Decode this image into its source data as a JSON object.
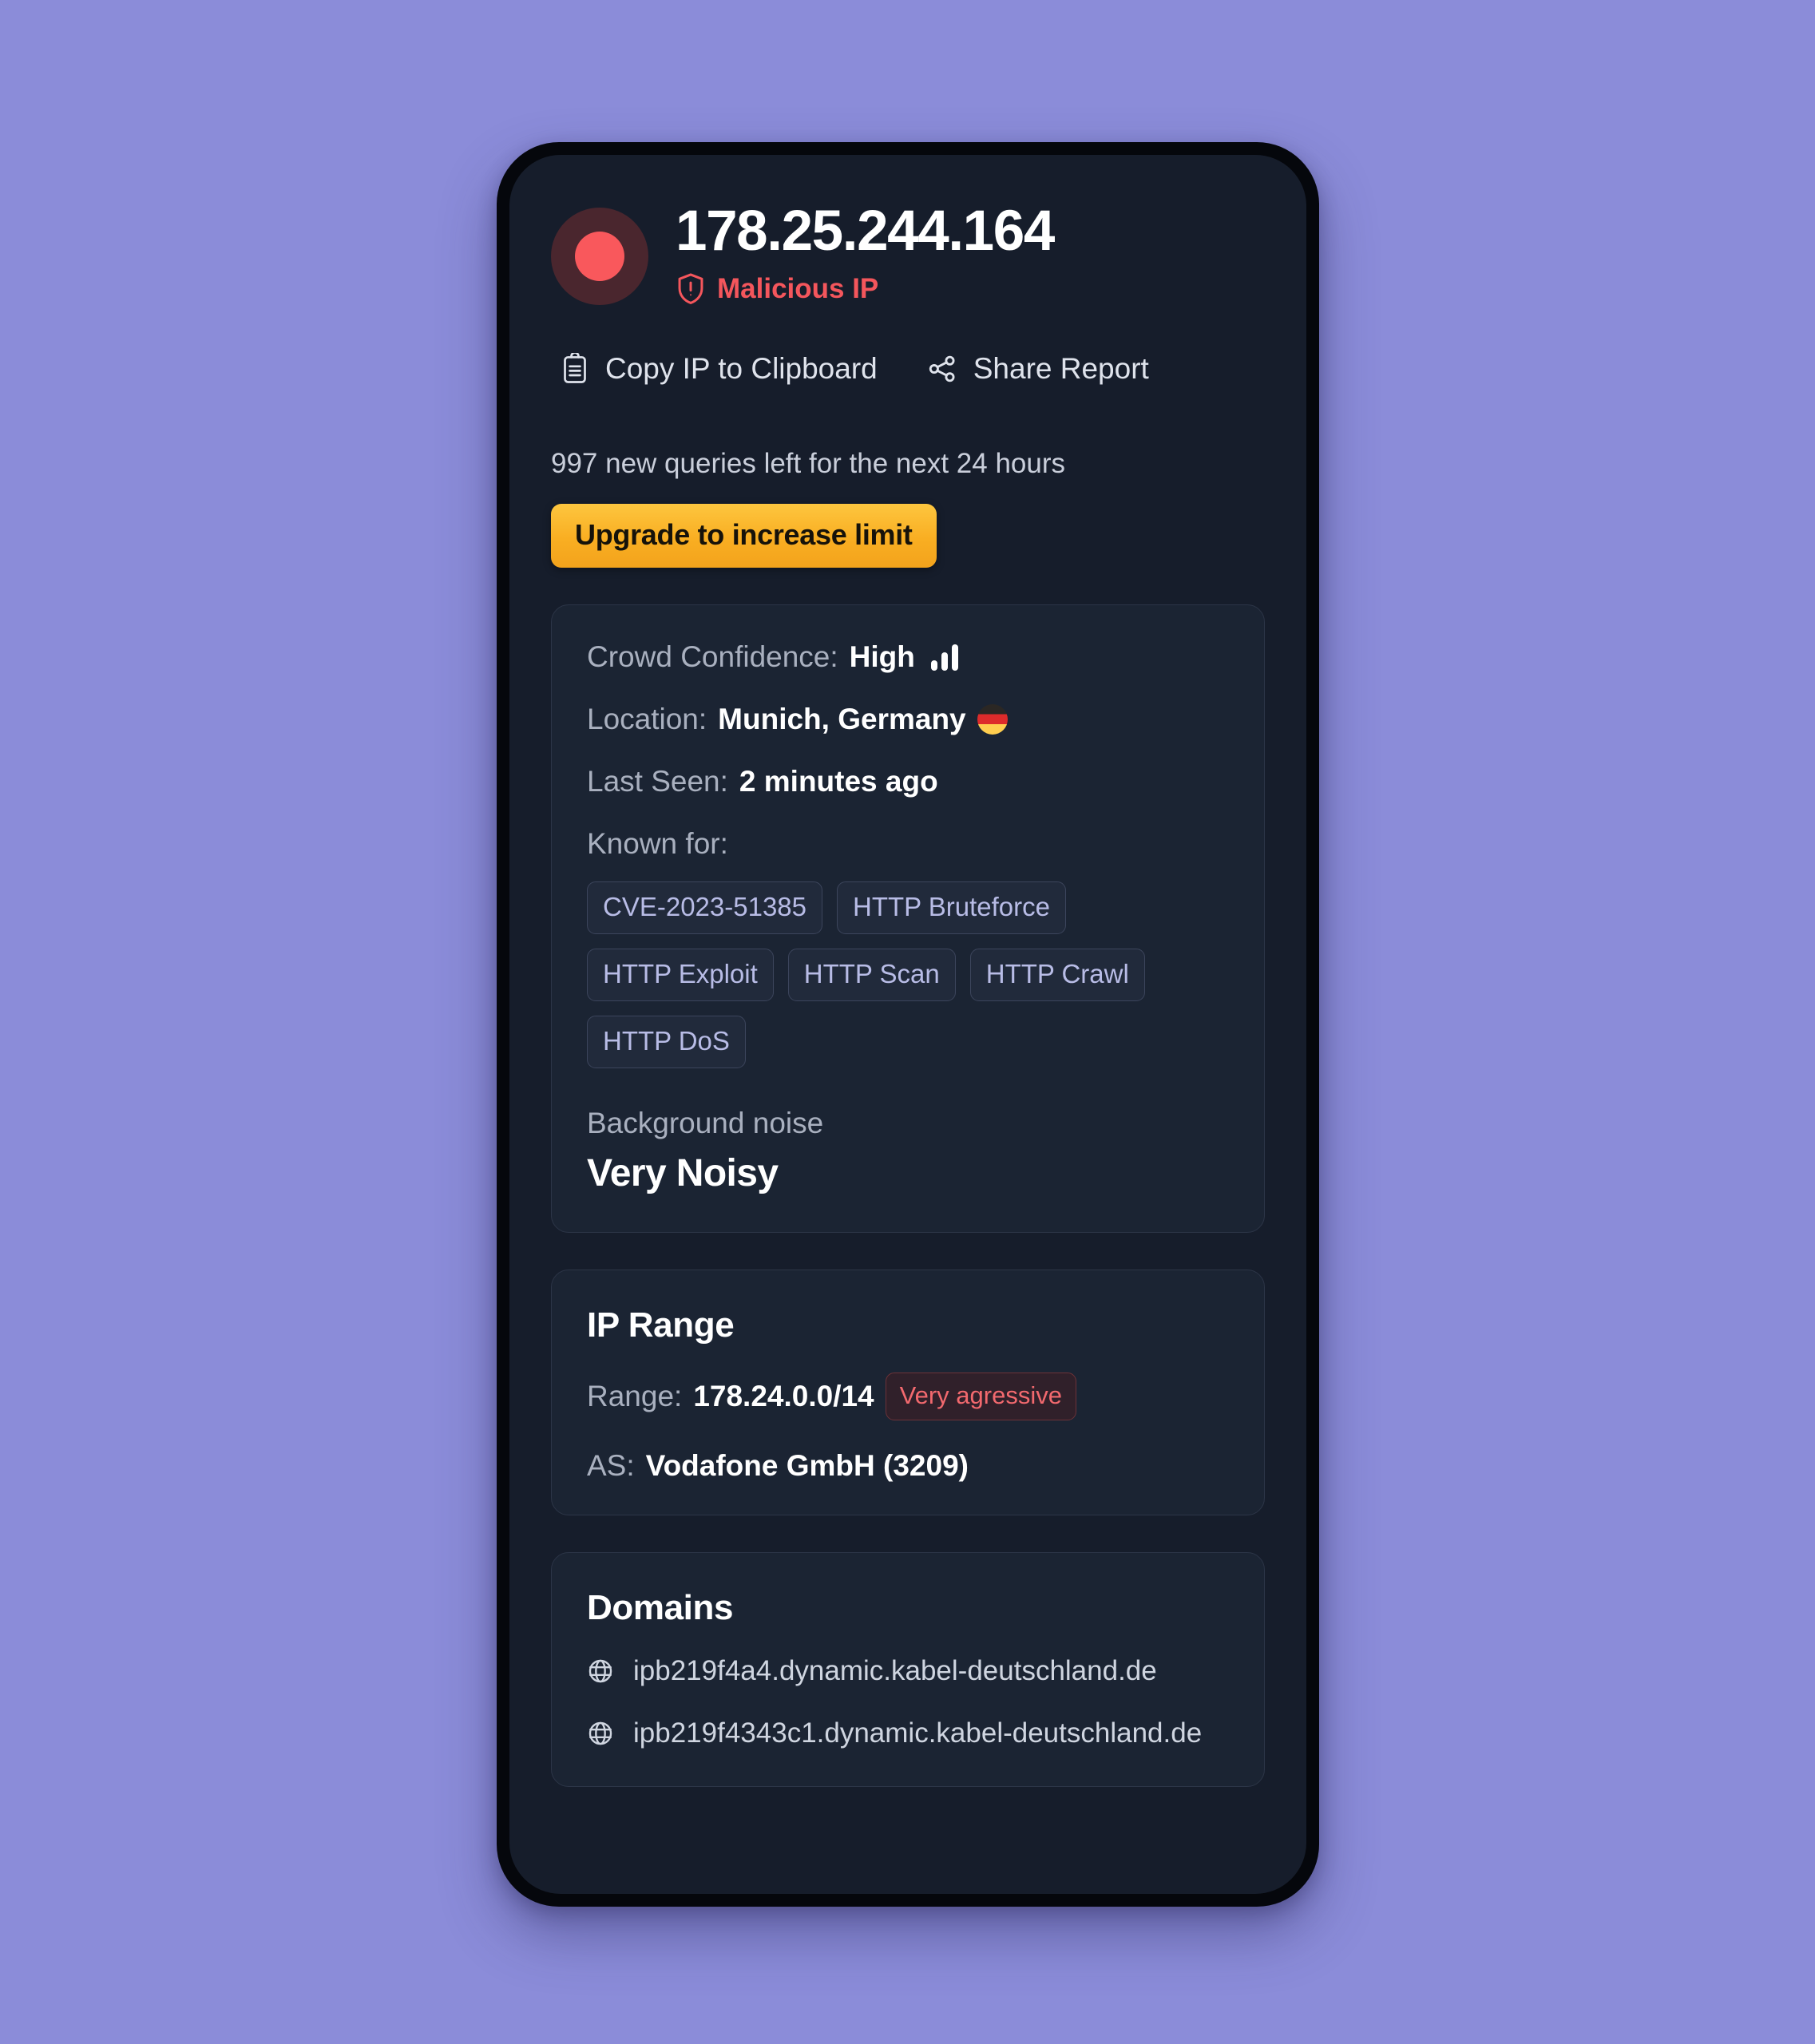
{
  "header": {
    "ip": "178.25.244.164",
    "verdict": "Malicious IP",
    "verdict_color": "#f4565c",
    "status_dot_color": "#f9585c"
  },
  "actions": {
    "copy_label": "Copy IP to Clipboard",
    "share_label": "Share Report"
  },
  "quota": {
    "text": "997 new queries left for the next 24 hours",
    "upgrade_label": "Upgrade to increase limit",
    "upgrade_color": "#f9ae22"
  },
  "details": {
    "crowd_confidence_label": "Crowd Confidence:",
    "crowd_confidence_value": "High",
    "location_label": "Location:",
    "location_value": "Munich, Germany",
    "last_seen_label": "Last Seen:",
    "last_seen_value": "2 minutes ago",
    "known_for_label": "Known for:",
    "tags": [
      "CVE-2023-51385",
      "HTTP Bruteforce",
      "HTTP Exploit",
      "HTTP Scan",
      "HTTP Crawl",
      "HTTP DoS"
    ],
    "noise_label": "Background noise",
    "noise_value": "Very Noisy"
  },
  "ip_range": {
    "title": "IP Range",
    "range_label": "Range:",
    "range_value": "178.24.0.0/14",
    "badge": "Very agressive",
    "badge_color": "#f2696e",
    "as_label": "AS:",
    "as_value": "Vodafone GmbH (3209)"
  },
  "domains": {
    "title": "Domains",
    "items": [
      "ipb219f4a4.dynamic.kabel-deutschland.de",
      "ipb219f4343c1.dynamic.kabel-deutschland.de"
    ]
  }
}
